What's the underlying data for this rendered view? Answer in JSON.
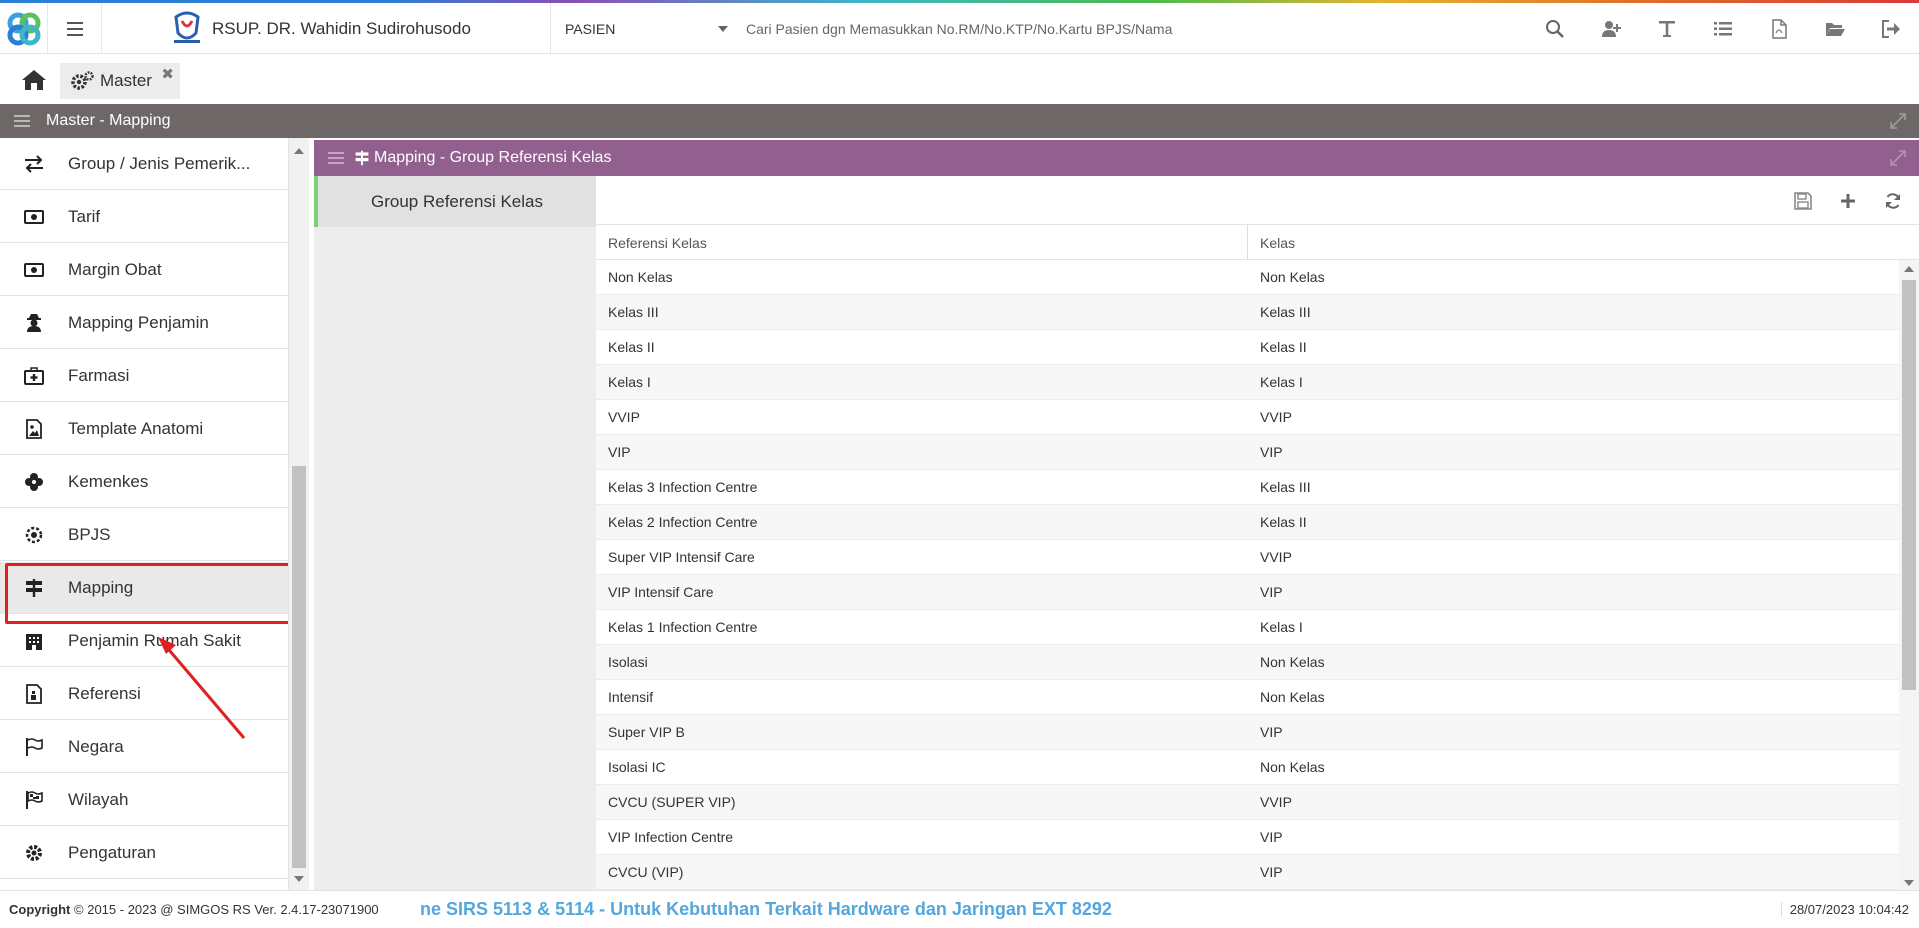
{
  "header": {
    "hospital_name": "RSUP. DR. Wahidin Sudirohusodo",
    "patient_select": "PASIEN",
    "search_placeholder": "Cari Pasien dgn Memasukkan No.RM/No.KTP/No.Kartu BPJS/Nama",
    "icons": [
      "search-icon",
      "add-user-icon",
      "text-icon",
      "list-icon",
      "pdf-icon",
      "folder-open-icon",
      "sign-out-icon"
    ]
  },
  "tabs": {
    "home_icon": "home-icon",
    "active_tab": "Master"
  },
  "section": {
    "title": "Master - Mapping"
  },
  "sidebar": {
    "items": [
      {
        "label": "Group / Jenis Pemerik...",
        "icon": "exchange-icon"
      },
      {
        "label": "Tarif",
        "icon": "money-icon"
      },
      {
        "label": "Margin Obat",
        "icon": "money-icon"
      },
      {
        "label": "Mapping Penjamin",
        "icon": "user-secret-icon"
      },
      {
        "label": "Farmasi",
        "icon": "medkit-icon"
      },
      {
        "label": "Template Anatomi",
        "icon": "image-icon"
      },
      {
        "label": "Kemenkes",
        "icon": "pinwheel-icon"
      },
      {
        "label": "BPJS",
        "icon": "gear-badge-icon"
      },
      {
        "label": "Mapping",
        "icon": "signpost-icon"
      },
      {
        "label": "Penjamin Rumah Sakit",
        "icon": "building-icon"
      },
      {
        "label": "Referensi",
        "icon": "file-icon"
      },
      {
        "label": "Negara",
        "icon": "flag-outline-icon"
      },
      {
        "label": "Wilayah",
        "icon": "checkered-flag-icon"
      },
      {
        "label": "Pengaturan",
        "icon": "gear-icon"
      }
    ],
    "active": "Mapping"
  },
  "panel": {
    "title": "Mapping - Group Referensi Kelas",
    "subnav_item": "Group Referensi Kelas",
    "toolbar_icons": [
      "save-icon",
      "plus-icon",
      "refresh-icon"
    ],
    "columns": [
      "Referensi Kelas",
      "Kelas"
    ],
    "rows": [
      [
        "Non Kelas",
        "Non Kelas"
      ],
      [
        "Kelas III",
        "Kelas III"
      ],
      [
        "Kelas II",
        "Kelas II"
      ],
      [
        "Kelas I",
        "Kelas I"
      ],
      [
        "VVIP",
        "VVIP"
      ],
      [
        "VIP",
        "VIP"
      ],
      [
        "Kelas 3 Infection Centre",
        "Kelas III"
      ],
      [
        "Kelas 2 Infection Centre",
        "Kelas II"
      ],
      [
        "Super VIP Intensif Care",
        "VVIP"
      ],
      [
        "VIP Intensif Care",
        "VIP"
      ],
      [
        "Kelas 1 Infection Centre",
        "Kelas I"
      ],
      [
        "Isolasi",
        "Non Kelas"
      ],
      [
        "Intensif",
        "Non Kelas"
      ],
      [
        "Super VIP B",
        "VIP"
      ],
      [
        "Isolasi IC",
        "Non Kelas"
      ],
      [
        "CVCU (SUPER VIP)",
        "VVIP"
      ],
      [
        "VIP Infection Centre",
        "VIP"
      ],
      [
        "CVCU (VIP)",
        "VIP"
      ]
    ]
  },
  "footer": {
    "copyright_label": "Copyright",
    "copyright_text": "2015 - 2023 @ SIMGOS RS Ver. 2.4.17-23071900",
    "marquee": "ne SIRS 5113 & 5114 - Untuk Kebutuhan Terkait Hardware dan Jaringan EXT 8292",
    "datetime": "28/07/2023 10:04:42"
  },
  "colors": {
    "section_bar": "#6d6767",
    "panel_header": "#91608f",
    "active_indicator": "#7ad07a",
    "annotation_red": "#e02020",
    "marquee_blue": "#54a7de"
  }
}
